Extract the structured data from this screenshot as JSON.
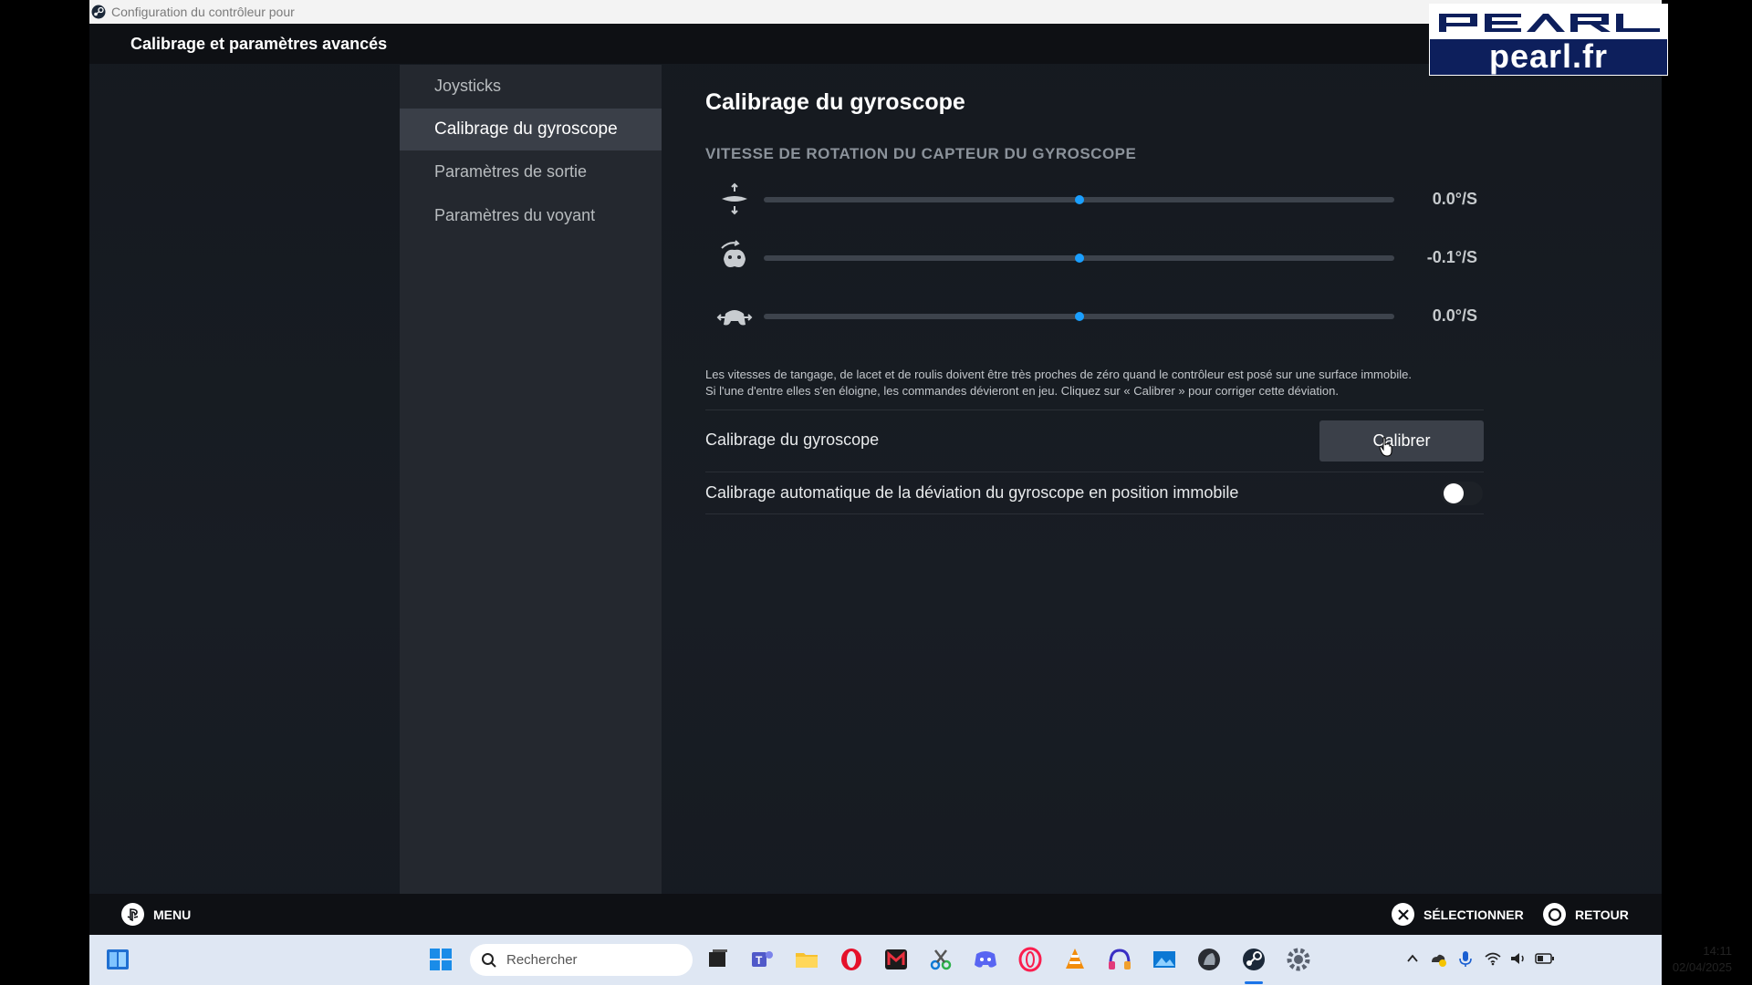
{
  "window": {
    "title": "Configuration du contrôleur pour",
    "header_title": "Calibrage et paramètres avancés"
  },
  "logo": {
    "wordmark": "PEARL",
    "domain": "pearl.fr"
  },
  "sidebar": {
    "items": [
      {
        "label": "Joysticks",
        "active": false
      },
      {
        "label": "Calibrage du gyroscope",
        "active": true
      },
      {
        "label": "Paramètres de sortie",
        "active": false
      },
      {
        "label": "Paramètres du voyant",
        "active": false
      }
    ]
  },
  "main": {
    "title": "Calibrage du gyroscope",
    "section_title": "VITESSE DE ROTATION DU CAPTEUR DU GYROSCOPE",
    "gyro_rows": [
      {
        "icon": "gyro-pitch-icon",
        "value_text": "0.0°/S",
        "level": 0.5
      },
      {
        "icon": "gyro-roll-icon",
        "value_text": "-0.1°/S",
        "level": 0.5
      },
      {
        "icon": "gyro-yaw-icon",
        "value_text": "0.0°/S",
        "level": 0.5
      }
    ],
    "description_line1": "Les vitesses de tangage, de lacet et de roulis doivent être très proches de zéro quand le contrôleur est posé sur une surface immobile.",
    "description_line2": "Si l'une d'entre elles s'en éloigne, les commandes dévieront en jeu. Cliquez sur « Calibrer » pour corriger cette déviation.",
    "calibrate_label": "Calibrage du gyroscope",
    "calibrate_button": "Calibrer",
    "auto_label": "Calibrage automatique de la déviation du gyroscope en position immobile",
    "auto_enabled": false
  },
  "footer": {
    "menu": "MENU",
    "select": "SÉLECTIONNER",
    "back": "RETOUR"
  },
  "taskbar": {
    "search_placeholder": "Rechercher",
    "time": "14:11",
    "date": "02/04/2025"
  },
  "colors": {
    "accent": "#1a9fff",
    "background": "#181d24",
    "sidebar": "#24282f",
    "taskbar": "#dfe7f3"
  }
}
